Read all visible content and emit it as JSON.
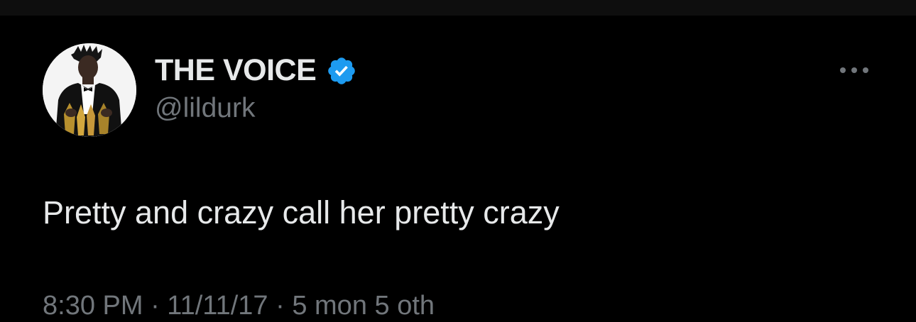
{
  "tweet": {
    "author": {
      "display_name": "THE VOICE",
      "handle": "@lildurk",
      "verified": true,
      "verified_icon": "verified-badge-icon",
      "verified_color": "#1d9bf0"
    },
    "text": "Pretty and crazy call her pretty crazy",
    "meta_partial": "8:30 PM · 11/11/17 ·  5 mon  5 oth",
    "more_icon": "more-horizontal-icon"
  },
  "colors": {
    "background": "#000000",
    "primary_text": "#e7e9ea",
    "secondary_text": "#71767b",
    "accent": "#1d9bf0"
  }
}
